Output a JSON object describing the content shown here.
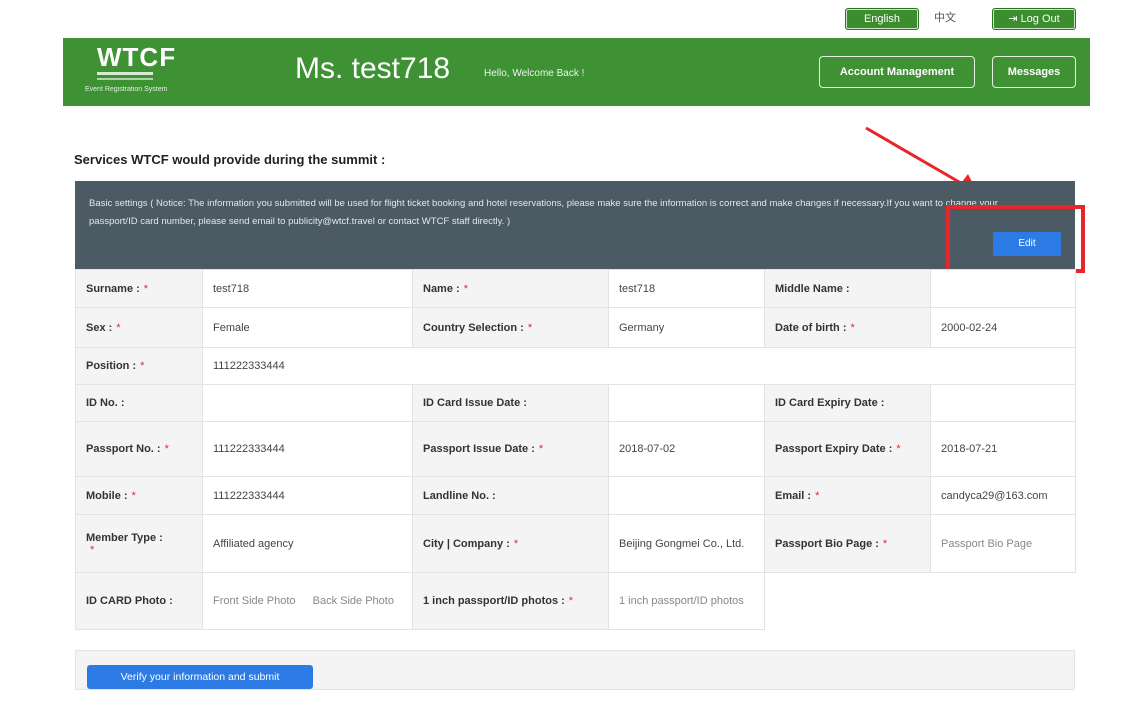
{
  "topbar": {
    "english_label": "English",
    "chinese_label": "中文",
    "logout_label": "Log Out"
  },
  "header": {
    "logo_text": "WTCF",
    "logo_sub": "Event Registration System",
    "user_name": "Ms. test718",
    "welcome": "Hello, Welcome Back !",
    "account_btn": "Account Management",
    "messages_btn": "Messages",
    "bg_color": "#3e9234"
  },
  "main": {
    "section_title": "Services WTCF would provide during the summit :",
    "notice": "Basic settings ( Notice: The information you submitted will be used for flight ticket booking and hotel reservations, please make sure the information is correct and make changes if necessary.If you want to change your passport/ID card number, please send email to publicity@wtcf.travel or contact WTCF staff directly. )",
    "edit_btn": "Edit",
    "submit_btn": "Verify your information and submit"
  },
  "form": {
    "surname_label": "Surname :",
    "surname_value": "test718",
    "name_label": "Name :",
    "name_value": "test718",
    "middle_label": "Middle Name :",
    "middle_value": "",
    "sex_label": "Sex :",
    "sex_value": "Female",
    "country_label": "Country Selection :",
    "country_value": "Germany",
    "dob_label": "Date of birth :",
    "dob_value": "2000-02-24",
    "position_label": "Position :",
    "position_value": "111222333444",
    "idno_label": "ID No. :",
    "idno_value": "",
    "idissue_label": "ID Card Issue Date :",
    "idissue_value": "",
    "idexpiry_label": "ID Card Expiry Date :",
    "idexpiry_value": "",
    "passport_label": "Passport No. :",
    "passport_value": "111222333444",
    "ppissue_label": "Passport Issue Date :",
    "ppissue_value": "2018-07-02",
    "ppexpiry_label": "Passport Expiry Date :",
    "ppexpiry_value": "2018-07-21",
    "mobile_label": "Mobile :",
    "mobile_value": "111222333444",
    "landline_label": "Landline No. :",
    "landline_value": "",
    "email_label": "Email :",
    "email_value": "candyca29@163.com",
    "member_label": "Member Type :",
    "member_value": "Affiliated agency",
    "city_label": "City | Company :",
    "city_value": "Beijing Gongmei Co., Ltd.",
    "bio_label": "Passport Bio Page :",
    "bio_value": "Passport Bio Page",
    "idcard_label": "ID CARD Photo :",
    "front_photo": "Front Side Photo",
    "back_photo": "Back Side Photo",
    "inch_label": "1 inch passport/ID photos :",
    "inch_value": "1 inch passport/ID photos",
    "required_mark": "*"
  },
  "colors": {
    "header_green": "#3e9234",
    "notice_bg": "#4c5a64",
    "primary_blue": "#2c7be5",
    "highlight_red": "#e8262a"
  }
}
